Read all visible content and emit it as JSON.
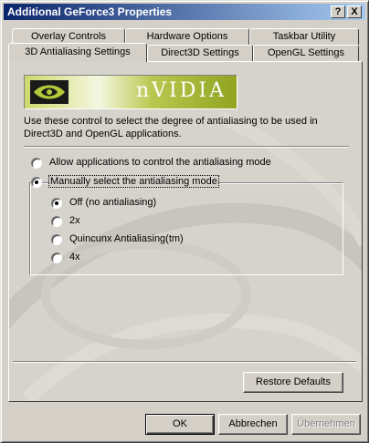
{
  "window": {
    "title": "Additional GeForce3 Properties",
    "help_glyph": "?",
    "close_glyph": "X"
  },
  "tabs": {
    "row_back": [
      "Overlay Controls",
      "Hardware Options",
      "Taskbar Utility"
    ],
    "row_front": [
      "3D Antialiasing Settings",
      "Direct3D Settings",
      "OpenGL Settings"
    ],
    "active": "3D Antialiasing Settings"
  },
  "panel": {
    "logo_text": "nVIDIA",
    "description": "Use these control to select the degree of antialiasing to be used in Direct3D and OpenGL applications.",
    "allow_apps_label": "Allow applications to control the antialiasing mode",
    "manual_label": "Manually select the antialiasing mode",
    "modes": [
      {
        "label": "Off (no antialiasing)",
        "checked": true
      },
      {
        "label": "2x",
        "checked": false
      },
      {
        "label": "Quincunx Antialiasing(tm)",
        "checked": false
      },
      {
        "label": "4x",
        "checked": false
      }
    ],
    "restore_defaults": "Restore Defaults"
  },
  "buttons": {
    "ok": "OK",
    "cancel": "Abbrechen",
    "apply": "Übernehmen"
  }
}
